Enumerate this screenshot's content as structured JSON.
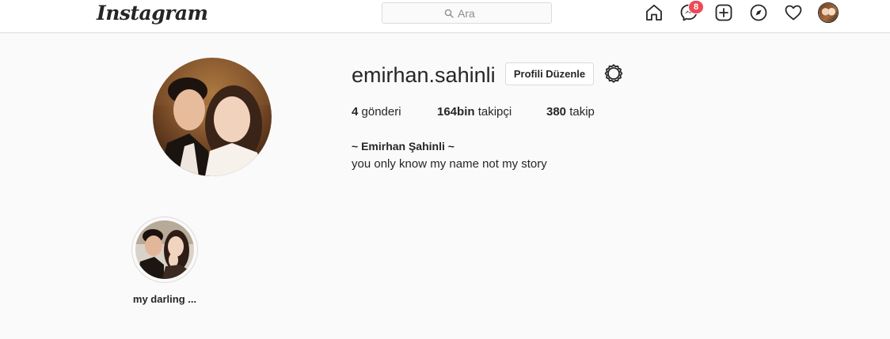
{
  "nav": {
    "logo": "Instagram",
    "search_placeholder": "Ara",
    "messages_badge": "8"
  },
  "profile": {
    "username": "emirhan.sahinli",
    "edit_button": "Profili Düzenle",
    "posts_count": "4",
    "posts_label": "gönderi",
    "followers_count": "164bin",
    "followers_label": "takipçi",
    "following_count": "380",
    "following_label": "takip",
    "full_name": "~ Emirhan Şahinli ~",
    "bio": "you only know my name not my story"
  },
  "highlights": [
    {
      "label": "my darling ..."
    }
  ],
  "colors": {
    "badge": "#ed4956",
    "border": "#dbdbdb",
    "background": "#fafafa",
    "text": "#262626"
  }
}
